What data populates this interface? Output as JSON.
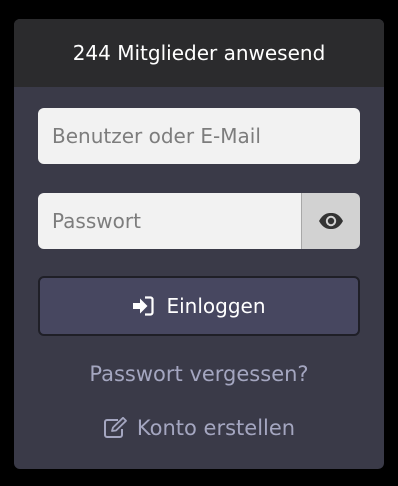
{
  "header": {
    "members_online": "244 Mitglieder anwesend"
  },
  "login_form": {
    "username_placeholder": "Benutzer oder E-Mail",
    "password_placeholder": "Passwort",
    "login_label": "Einloggen",
    "forgot_password_label": "Passwort vergessen?",
    "create_account_label": "Konto erstellen"
  },
  "icons": {
    "password_toggle": "eye-icon",
    "login": "sign-in-icon",
    "create_account": "edit-icon"
  },
  "colors": {
    "panel_background": "#3a3a48",
    "header_background": "#2b2b2d",
    "button_background": "#474760",
    "link_color": "#a4a6c0"
  }
}
